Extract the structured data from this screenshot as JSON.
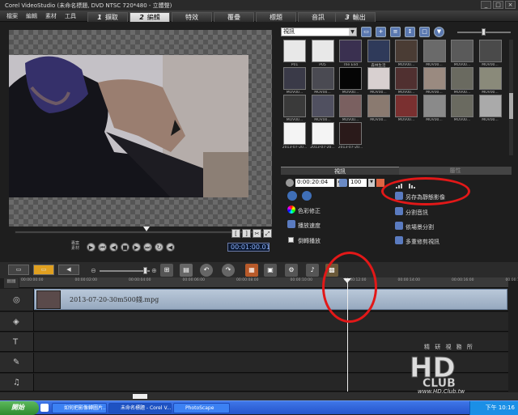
{
  "window": {
    "title": "Corel VideoStudio (未命名標題, DVD NTSC 720*480 - 立體聲)",
    "controls": [
      "_",
      "□",
      "×"
    ]
  },
  "menu": {
    "items": [
      "檔案",
      "編輯",
      "素材",
      "工具"
    ]
  },
  "steps": [
    {
      "num": "1",
      "label": "擷取",
      "active": false
    },
    {
      "num": "2",
      "label": "編輯",
      "active": true
    },
    {
      "num": "",
      "label": "特效",
      "active": false
    },
    {
      "num": "",
      "label": "覆疊",
      "active": false
    },
    {
      "num": "",
      "label": "標題",
      "active": false
    },
    {
      "num": "",
      "label": "音訊",
      "active": false
    },
    {
      "num": "3",
      "label": "輸出",
      "active": false
    }
  ],
  "player": {
    "timecode": "00:01:00.01",
    "square_buttons": [
      "[",
      "]",
      "✂",
      "⤢"
    ],
    "labels": {
      "project": "專案",
      "clip": "素材"
    }
  },
  "library": {
    "category": "視訊",
    "tiles": [
      {
        "label": "P01"
      },
      {
        "label": "P05"
      },
      {
        "label": "The End"
      },
      {
        "label": "森林生活"
      },
      {
        "label": "MOV00..."
      },
      {
        "label": "MOV00..."
      },
      {
        "label": "MOV00..."
      },
      {
        "label": "MOV00..."
      },
      {
        "label": "MOV00..."
      },
      {
        "label": "MOV00..."
      },
      {
        "label": "MOV00..."
      },
      {
        "label": "MOV00..."
      },
      {
        "label": "MOV00..."
      },
      {
        "label": "MOV00..."
      },
      {
        "label": "MOV00..."
      },
      {
        "label": "MOV00..."
      },
      {
        "label": "MOV00..."
      },
      {
        "label": "MOV00..."
      },
      {
        "label": "MOV00..."
      },
      {
        "label": "MOV00..."
      },
      {
        "label": "MOV00..."
      },
      {
        "label": "MOV00..."
      },
      {
        "label": "MOV00..."
      },
      {
        "label": "MOV00..."
      },
      {
        "label": "2013-07-20..."
      },
      {
        "label": "2013-07-20..."
      },
      {
        "label": "2013-07-20..."
      }
    ]
  },
  "options": {
    "tab_video": "視訊",
    "tab_attr": "屬性",
    "duration": "0:00:20:04",
    "volume": "100",
    "items": {
      "color_correct": "色彩修正",
      "speed": "播放速度",
      "reverse": "倒轉播放",
      "save_frame": "另存為靜態影像",
      "split_audio": "分割音訊",
      "scene_split": "依場景分割",
      "multi_trim": "多重修剪視訊"
    }
  },
  "timeline": {
    "ruler": [
      "00:00:00:00",
      "00:00:02:00",
      "00:00:04:00",
      "00:00:06:00",
      "00:00:08:00",
      "00:00:10:00",
      "00:00:12:00",
      "00:00:14:00",
      "00:00:16:00",
      "00:00:18:00"
    ],
    "clip_name": "2013-07-20-30m500錢.mpg",
    "track_icons": [
      "video-track",
      "overlay-track",
      "title-track",
      "voice-track",
      "music-track"
    ]
  },
  "watermark": {
    "line1": "精 研 視 務 所",
    "url": "www.HD.Club.tw"
  },
  "taskbar": {
    "start": "開始",
    "tasks": [
      {
        "label": "如何把影像轉圖片...",
        "active": false
      },
      {
        "label": "未命名標題 - Corel V...",
        "active": true
      },
      {
        "label": "PhotoScape",
        "active": false
      }
    ],
    "clock": "下午 10:16"
  }
}
